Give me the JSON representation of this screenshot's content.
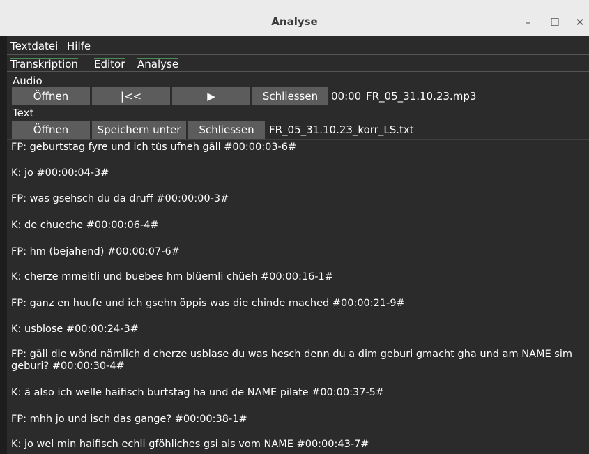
{
  "window": {
    "title": "Analyse",
    "controls": {
      "minimize": "–",
      "maximize": "☐",
      "close": "✕"
    }
  },
  "menubar": {
    "items": [
      "Textdatei",
      "Hilfe"
    ]
  },
  "tabs": [
    "Transkription",
    "Editor",
    "Analyse"
  ],
  "audio": {
    "label": "Audio",
    "open_label": "Öffnen",
    "rewind_label": "|<<",
    "play_label": "▶",
    "close_label": "Schliessen",
    "time": "00:00",
    "filename": "FR_05_31.10.23.mp3"
  },
  "text_section": {
    "label": "Text",
    "open_label": "Öffnen",
    "save_as_label": "Speichern unter",
    "close_label": "Schliessen",
    "filename": "FR_05_31.10.23_korr_LS.txt"
  },
  "transcript": [
    "FP: geburtstag fyre und ich tùs ufneh gäll #00:00:03-6#",
    "K: jo #00:00:04-3#",
    "FP: was gsehsch du da druff #00:00:00-3#",
    "K: de chueche #00:00:06-4#",
    "FP: hm (bejahend) #00:00:07-6#",
    "K: cherze mmeitli und buebee hm blüemli chüeh #00:00:16-1#",
    "FP: ganz en huufe und ich gsehn öppis was die chinde mached #00:00:21-9#",
    "K: usblose #00:00:24-3#",
    "FP: gäll die wönd nämlich d cherze usblase du was hesch denn du a dim geburi gmacht gha und am NAME sim geburi? #00:00:30-4#",
    "K: ä also ich welle haifisch burtstag ha und de NAME pilate #00:00:37-5#",
    "FP: mhh jo und isch das gange? #00:00:38-1#",
    "K: jo wel min haifisch echli gföhliches gsi als vom NAME #00:00:43-7#"
  ]
}
